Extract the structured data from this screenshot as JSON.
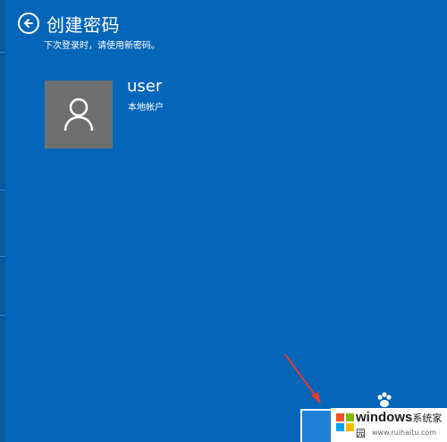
{
  "header": {
    "title": "创建密码",
    "back_icon": "back-arrow-icon"
  },
  "subtitle": "下次登录时，请使用新密码。",
  "account": {
    "username": "user",
    "account_type": "本地帐户",
    "avatar_icon": "user-silhouette-icon"
  },
  "watermark": {
    "name": "windows",
    "name_cn": "系统家园",
    "url": "www.ruihaitu.com"
  },
  "colors": {
    "background": "#0565b8",
    "avatar_bg": "#6f6f6f",
    "button": "#1e7fd6",
    "annotation_arrow": "#e53935"
  }
}
